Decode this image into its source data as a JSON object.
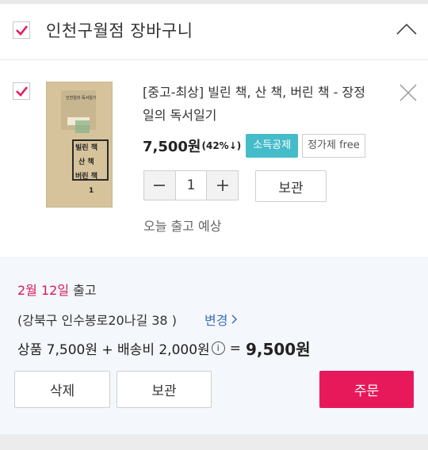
{
  "store": {
    "title": "인천구월점 장바구니",
    "checked": true
  },
  "item": {
    "checked": true,
    "cover_text": {
      "top": "인천일의 독서일기",
      "line1": "빌린 책",
      "line2": "산 책",
      "line3": "버린 책",
      "num": "1"
    },
    "title_line1": "[중고-최상] 빌린 책, 산 책, 버린 책 - 장정",
    "title_line2": "일의 독서일기",
    "price": "7,500원",
    "discount": "(42%↓)",
    "tag_primary": "소득공제",
    "tag_secondary": "정가제 free",
    "quantity": "1",
    "save_label": "보관",
    "ship_note": "오늘 출고 예상"
  },
  "summary": {
    "ship_date": "2월 12일",
    "ship_word": "출고",
    "address": "(강북구 인수봉로20나길 38 )",
    "change_label": "변경",
    "total_prefix": "상품 7,500원 + 배송비 2,000원",
    "total_equals": "=",
    "total_amount": "9,500원",
    "delete_label": "삭제",
    "save_label": "보관",
    "order_label": "주문"
  },
  "colors": {
    "accent": "#e8195b",
    "tag_blue": "#45bcc9",
    "link": "#3f6fb5"
  }
}
